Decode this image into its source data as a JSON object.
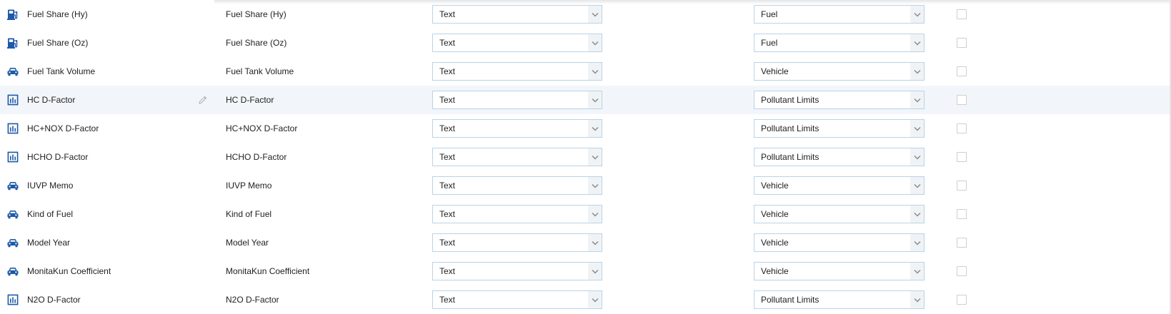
{
  "rows": [
    {
      "icon": "fuel-pump-icon",
      "name": "Fuel Share (Hy)",
      "label": "Fuel Share (Hy)",
      "type": "Text",
      "category": "Fuel",
      "checked": false
    },
    {
      "icon": "fuel-pump-icon",
      "name": "Fuel Share (Oz)",
      "label": "Fuel Share (Oz)",
      "type": "Text",
      "category": "Fuel",
      "checked": false
    },
    {
      "icon": "car-icon",
      "name": "Fuel Tank Volume",
      "label": "Fuel Tank Volume",
      "type": "Text",
      "category": "Vehicle",
      "checked": false
    },
    {
      "icon": "bar-chart-icon",
      "name": "HC D-Factor",
      "label": "HC D-Factor",
      "type": "Text",
      "category": "Pollutant Limits",
      "checked": false,
      "hovered": true
    },
    {
      "icon": "bar-chart-icon",
      "name": "HC+NOX D-Factor",
      "label": "HC+NOX D-Factor",
      "type": "Text",
      "category": "Pollutant Limits",
      "checked": false
    },
    {
      "icon": "bar-chart-icon",
      "name": "HCHO D-Factor",
      "label": "HCHO D-Factor",
      "type": "Text",
      "category": "Pollutant Limits",
      "checked": false
    },
    {
      "icon": "car-icon",
      "name": "IUVP Memo",
      "label": "IUVP Memo",
      "type": "Text",
      "category": "Vehicle",
      "checked": false
    },
    {
      "icon": "car-icon",
      "name": "Kind of Fuel",
      "label": "Kind of Fuel",
      "type": "Text",
      "category": "Vehicle",
      "checked": false
    },
    {
      "icon": "car-icon",
      "name": "Model Year",
      "label": "Model Year",
      "type": "Text",
      "category": "Vehicle",
      "checked": false
    },
    {
      "icon": "car-icon",
      "name": "MonitaKun Coefficient",
      "label": "MonitaKun Coefficient",
      "type": "Text",
      "category": "Vehicle",
      "checked": false
    },
    {
      "icon": "bar-chart-icon",
      "name": "N2O D-Factor",
      "label": "N2O D-Factor",
      "type": "Text",
      "category": "Pollutant Limits",
      "checked": false
    }
  ],
  "colors": {
    "icon": "#1e5aa8",
    "select_border": "#b9d3e8",
    "row_highlight": "#f2f6fa"
  }
}
